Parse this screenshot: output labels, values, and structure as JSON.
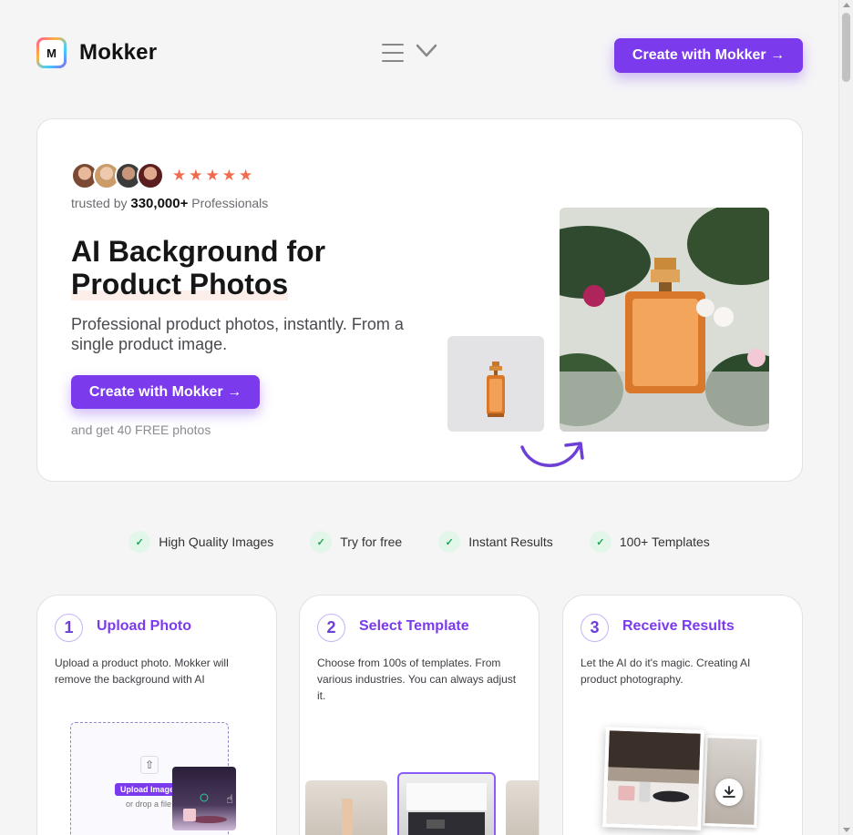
{
  "header": {
    "logo_letter": "M",
    "brand": "Mokker",
    "cta_label": "Create with Mokker →"
  },
  "hero": {
    "rating_stars": 5,
    "trusted_prefix": "trusted by",
    "trusted_count": "330,000+",
    "trusted_suffix": "Professionals",
    "title_line1": "AI Background for",
    "title_line2": "Product Photos",
    "subtitle": "Professional product photos, instantly. From a single product image.",
    "cta_label": "Create with Mokker →",
    "note": "and get 40 FREE photos"
  },
  "features": [
    {
      "label": "High Quality Images"
    },
    {
      "label": "Try for free"
    },
    {
      "label": "Instant Results"
    },
    {
      "label": "100+ Templates"
    }
  ],
  "steps": [
    {
      "num": "1",
      "title": "Upload Photo",
      "desc": "Upload a product photo. Mokker will remove the background with AI"
    },
    {
      "num": "2",
      "title": "Select Template",
      "desc": "Choose from 100s of templates. From various industries. You can always adjust it."
    },
    {
      "num": "3",
      "title": "Receive Results",
      "desc": "Let the AI do it's magic. Creating AI product photography."
    }
  ],
  "upload_widget": {
    "button_label": "Upload Image",
    "drop_label": "or drop a file"
  },
  "colors": {
    "accent": "#7c3aed",
    "star": "#f06c4e",
    "check_bg": "#e3f6ea",
    "check": "#22a55a"
  }
}
